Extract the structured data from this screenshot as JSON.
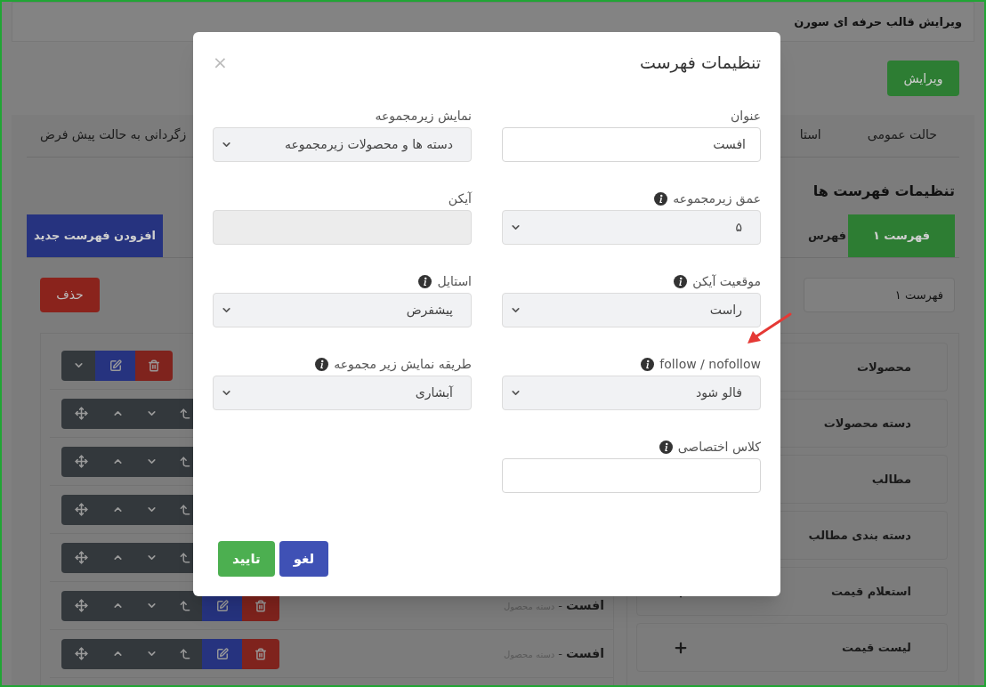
{
  "page_title": "ویرایش قالب حرفه ای سورن",
  "edit_button": "ویرایش",
  "top_tabs": [
    "حالت عمومی",
    "استا"
  ],
  "reset_link": "زگردانی به حالت پیش فرض",
  "menus_heading": "تنظیمات فهرست ها",
  "menu_tabs": [
    {
      "label": "فهرست ۱",
      "selected": true
    },
    {
      "label": "فهرس",
      "selected": false
    }
  ],
  "add_menu_button": "افزودن فهرست جدید",
  "delete_button": "حذف",
  "menu_name_field": {
    "value": "فهرست ۱"
  },
  "tree_rows": [
    {
      "kind": "root"
    },
    {
      "kind": "partial"
    },
    {
      "kind": "partial"
    },
    {
      "kind": "partial"
    },
    {
      "kind": "partial"
    },
    {
      "kind": "item",
      "title": "افست",
      "separator": "-",
      "subtitle": "دسته محصول"
    },
    {
      "kind": "item",
      "title": "افست",
      "separator": "-",
      "subtitle": "دسته محصول"
    }
  ],
  "item_types": [
    {
      "label": "محصولات"
    },
    {
      "label": "دسته محصولات"
    },
    {
      "label": "مطالب"
    },
    {
      "label": "دسته بندی مطالب"
    },
    {
      "label": "استعلام قیمت",
      "addable": true
    },
    {
      "label": "لیست قیمت",
      "addable": true
    }
  ],
  "modal": {
    "title": "تنظیمات فهرست",
    "close": "×",
    "columns": [
      [
        {
          "label": "عنوان",
          "info": false,
          "kind": "text",
          "value": "افست"
        },
        {
          "label": "عمق زیرمجموعه",
          "info": true,
          "kind": "select",
          "value": "۵"
        },
        {
          "label": "موقعیت آیکن",
          "info": true,
          "kind": "select",
          "value": "راست"
        },
        {
          "label": "follow / nofollow",
          "info": true,
          "kind": "select",
          "value": "فالو شود"
        },
        {
          "label": "کلاس اختصاصی",
          "info": true,
          "kind": "text"
        }
      ],
      [
        {
          "label": "نمایش زیرمجموعه",
          "info": false,
          "kind": "select",
          "value": "دسته ها و محصولات زیرمجموعه"
        },
        {
          "label": "آیکن",
          "info": false,
          "kind": "disabled"
        },
        {
          "label": "استایل",
          "info": true,
          "kind": "select",
          "value": "پیشفرض"
        },
        {
          "label": "طریقه نمایش زیر مجموعه",
          "info": true,
          "kind": "select",
          "value": "آبشاری"
        }
      ]
    ],
    "buttons": [
      {
        "label": "لغو",
        "kind": "cancel"
      },
      {
        "label": "تایید",
        "kind": "confirm"
      }
    ]
  }
}
